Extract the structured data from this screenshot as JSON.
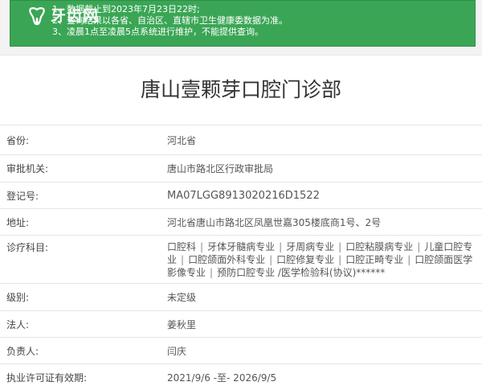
{
  "notice": {
    "lines": [
      "1、数据截止到2023年7月23日22时;",
      "2、查询结果以各省、自治区、直辖市卫生健康委数据为准。",
      "3、凌晨1点至凌晨5点系统进行维护，不能提供查询。"
    ],
    "watermark_text": "牙齿网"
  },
  "title": "唐山壹颗芽口腔门诊部",
  "fields": {
    "province": {
      "label": "省份:",
      "value": "河北省"
    },
    "authority": {
      "label": "审批机关:",
      "value": "唐山市路北区行政审批局"
    },
    "reg_no": {
      "label": "登记号:",
      "value": "MA07LGG8913020216D1522"
    },
    "address": {
      "label": "地址:",
      "value": "河北省唐山市路北区凤凰世嘉305楼底商1号、2号"
    },
    "subjects": {
      "label": "诊疗科目:",
      "items": [
        "口腔科",
        "牙体牙髓病专业",
        "牙周病专业",
        "口腔粘膜病专业",
        "儿童口腔专业",
        "口腔颌面外科专业",
        "口腔修复专业",
        "口腔正畸专业",
        "口腔颌面医学影像专业",
        "预防口腔专业 /医学检验科(协议)******"
      ]
    },
    "level": {
      "label": "级别:",
      "value": "未定级"
    },
    "legal": {
      "label": "法人:",
      "value": "姜秋里"
    },
    "principal": {
      "label": "负责人:",
      "value": "闫庆"
    },
    "validity": {
      "label": "执业许可证有效期:",
      "value": "2021/9/6 -至- 2026/9/5"
    }
  },
  "colors": {
    "notice_bg": "#3aa655",
    "card_bg": "#ffffff",
    "page_bg": "#f3f3f3"
  }
}
